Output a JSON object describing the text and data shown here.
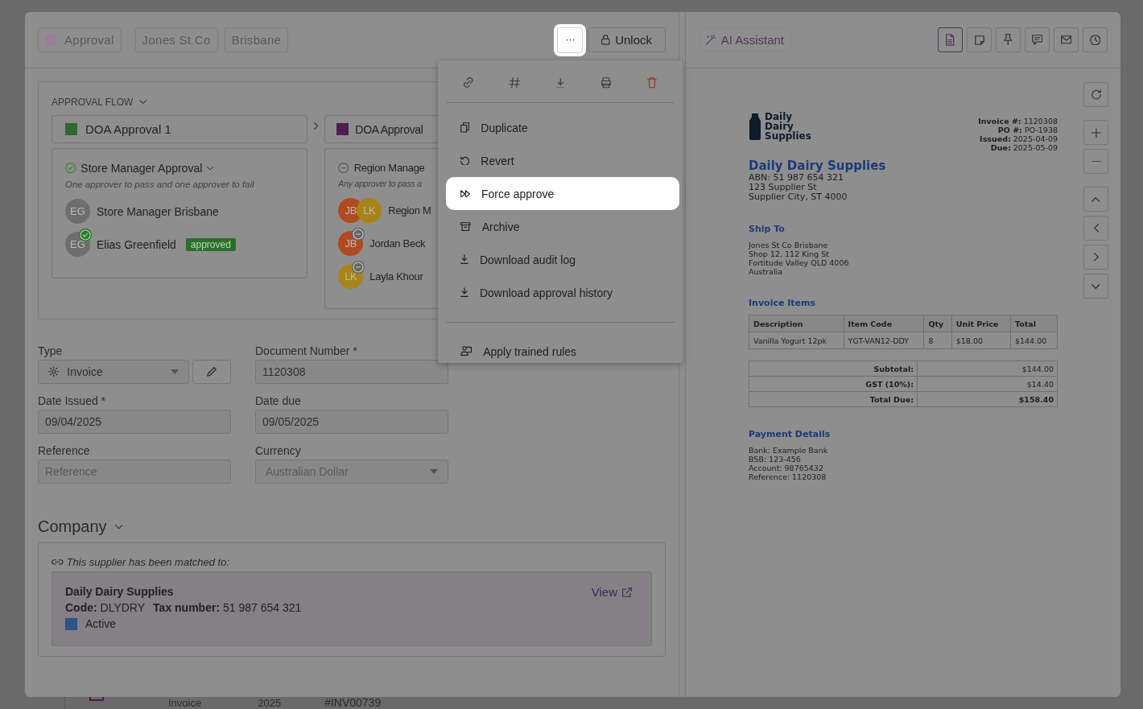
{
  "header": {
    "tags": [
      {
        "label": "Approval",
        "color": "#9a7f9c"
      },
      {
        "label": "Jones St Co"
      },
      {
        "label": "Brisbane"
      }
    ],
    "unlock_button": "Unlock"
  },
  "approval_flow": {
    "title": "APPROVAL FLOW",
    "stages": [
      {
        "name": "DOA Approval 1",
        "color": "#2e6a2e",
        "step": {
          "title": "Store Manager Approval",
          "approved": true,
          "rule": "One approver to pass and one approver to fail",
          "approvers": [
            {
              "avatars": [
                {
                  "initials": "EG",
                  "color": "#6e6e6e"
                }
              ],
              "name": "Store Manager Brisbane",
              "approved": false,
              "pending": false
            },
            {
              "avatars": [
                {
                  "initials": "EG",
                  "color": "#6e6e6e"
                }
              ],
              "name": "Elias Greenfield",
              "approved": true,
              "pending": false,
              "badge": "approved"
            }
          ]
        }
      },
      {
        "name": "DOA Approval",
        "color": "#4e1e52",
        "step": {
          "title": "Region Manage",
          "approved": false,
          "rule": "Any approver to pass a",
          "approvers": [
            {
              "avatars": [
                {
                  "initials": "JB",
                  "color": "#b04a20"
                },
                {
                  "initials": "LK",
                  "color": "#a88418"
                }
              ],
              "name": "Region M",
              "approved": false,
              "pending": false
            },
            {
              "avatars": [
                {
                  "initials": "JB",
                  "color": "#b04a20"
                }
              ],
              "name": "Jordan Beck",
              "approved": false,
              "pending": true
            },
            {
              "avatars": [
                {
                  "initials": "LK",
                  "color": "#a88418"
                }
              ],
              "name": "Layla Khour",
              "approved": false,
              "pending": true
            }
          ]
        }
      }
    ]
  },
  "form": {
    "fields": [
      {
        "kind": "select",
        "label": "Type",
        "value": "Invoice",
        "disabled": false
      },
      {
        "kind": "text",
        "label": "Document Number *",
        "value": "1120308"
      },
      {
        "kind": "text",
        "label": "Date Issued *",
        "value": "09/04/2025"
      },
      {
        "kind": "text",
        "label": "Date due",
        "value": "09/05/2025"
      },
      {
        "kind": "text",
        "label": "Reference",
        "placeholder": "Reference"
      },
      {
        "kind": "select",
        "label": "Currency",
        "value": "Australian Dollar",
        "disabled": true
      }
    ]
  },
  "company": {
    "title": "Company",
    "matched_note": "This supplier has been matched to:",
    "supplier": {
      "name": "Daily Dairy Supplies",
      "code_label": "Code:",
      "code": "DLYDRY",
      "tax_label": "Tax number:",
      "tax_number": "51 987 654 321",
      "status": {
        "label": "Active",
        "color": "#2a5586"
      },
      "view_link": "View"
    }
  },
  "more_menu": {
    "icon_actions": [
      {
        "kind": "link"
      },
      {
        "kind": "hash"
      },
      {
        "kind": "download"
      },
      {
        "kind": "print"
      },
      {
        "kind": "delete"
      }
    ],
    "sections": [
      [
        {
          "kind": "duplicate",
          "label": "Duplicate",
          "selected": false
        },
        {
          "kind": "revert",
          "label": "Revert",
          "selected": false
        },
        {
          "kind": "force",
          "label": "Force approve",
          "selected": true
        },
        {
          "kind": "archive",
          "label": "Archive",
          "selected": false
        },
        {
          "kind": "download",
          "label": "Download audit log",
          "selected": false
        },
        {
          "kind": "download",
          "label": "Download approval history",
          "selected": false
        }
      ],
      [
        {
          "kind": "rules",
          "label": "Apply trained rules",
          "selected": false
        }
      ]
    ]
  },
  "viewer": {
    "ai_button": "AI Assistant",
    "view_tabs": [
      {
        "kind": "document",
        "selected": true
      },
      {
        "kind": "note",
        "selected": false
      },
      {
        "kind": "pin",
        "selected": false
      },
      {
        "kind": "comment",
        "selected": false
      },
      {
        "kind": "mail",
        "selected": false
      },
      {
        "kind": "history",
        "selected": false
      }
    ],
    "document": {
      "logo": [
        "Daily",
        "Dairy",
        "Supplies"
      ],
      "meta": [
        {
          "label": "Invoice #:",
          "value": "1120308"
        },
        {
          "label": "PO #:",
          "value": "PO-1938"
        },
        {
          "label": "Issued:",
          "value": "2025-04-09"
        },
        {
          "label": "Due:",
          "value": "2025-05-09"
        }
      ],
      "supplier_name": "Daily Dairy Supplies",
      "supplier_lines": [
        "ABN: 51 987 654 321",
        "123 Supplier St",
        "Supplier City, ST 4000"
      ],
      "ship_to_title": "Ship To",
      "ship_to_lines": [
        "Jones St Co Brisbane",
        "Shop 12, 112 King St",
        "Fortitude Valley QLD 4006",
        "Australia"
      ],
      "items_title": "Invoice Items",
      "columns": [
        "Description",
        "Item Code",
        "Qty",
        "Unit Price",
        "Total"
      ],
      "rows": [
        [
          "Vanilla Yogurt 12pk",
          "YGT-VAN12-DDY",
          "8",
          "$18.00",
          "$144.00"
        ]
      ],
      "totals": [
        {
          "label": "Subtotal:",
          "value": "$144.00",
          "bold": false
        },
        {
          "label": "GST (10%):",
          "value": "$14.40",
          "bold": false
        },
        {
          "label": "Total Due:",
          "value": "$158.40",
          "bold": true
        }
      ],
      "payment_title": "Payment Details",
      "payment_lines": [
        "Bank: Example Bank",
        "BSB: 123-456",
        "Account: 98765432",
        "Reference: 1120308"
      ]
    }
  },
  "background_row": [
    "Invoice",
    "2025",
    "#INV00739"
  ]
}
